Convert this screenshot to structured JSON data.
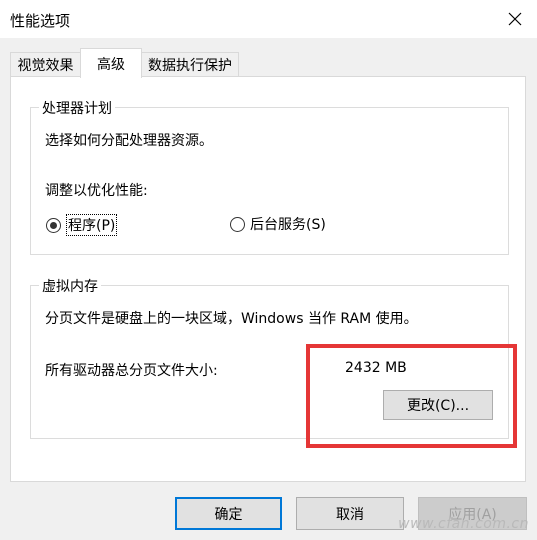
{
  "window": {
    "title": "性能选项"
  },
  "tabs": [
    {
      "label": "视觉效果"
    },
    {
      "label": "高级"
    },
    {
      "label": "数据执行保护"
    }
  ],
  "processor": {
    "legend": "处理器计划",
    "description": "选择如何分配处理器资源。",
    "adjust_label": "调整以优化性能:",
    "option_programs": "程序(P)",
    "option_background": "后台服务(S)",
    "selected": "programs"
  },
  "virtual_memory": {
    "legend": "虚拟内存",
    "description": "分页文件是硬盘上的一块区域，Windows 当作 RAM 使用。",
    "total_label": "所有驱动器总分页文件大小:",
    "total_value": "2432 MB",
    "change_button": "更改(C)..."
  },
  "footer": {
    "ok": "确定",
    "cancel": "取消",
    "apply": "应用(A)"
  },
  "watermark": "www.cfan.com.cn",
  "colors": {
    "highlight_box": "#e53636",
    "default_button_border": "#0078d7"
  }
}
